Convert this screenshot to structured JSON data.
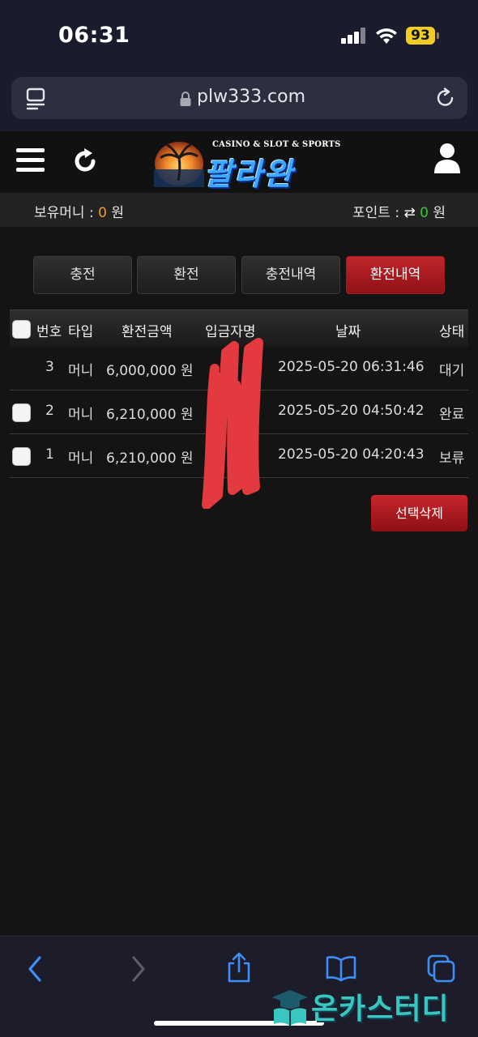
{
  "status_bar": {
    "time": "06:31",
    "battery": "93"
  },
  "browser": {
    "url": "plw333.com"
  },
  "header": {
    "logo_tagline": "CASINO & SLOT & SPORTS",
    "logo_name": "팔라완"
  },
  "balance": {
    "money_label": "보유머니 : ",
    "money_value": "0",
    "money_unit": " 원",
    "point_label": "포인트 : ",
    "point_swap_glyph": "⇄",
    "point_value": "0",
    "point_unit": " 원"
  },
  "tabs": [
    {
      "label": "충전",
      "active": false
    },
    {
      "label": "환전",
      "active": false
    },
    {
      "label": "충전내역",
      "active": false
    },
    {
      "label": "환전내역",
      "active": true
    }
  ],
  "table": {
    "columns": [
      "번호",
      "타입",
      "환전금액",
      "입금자명",
      "날짜",
      "상태"
    ],
    "rows": [
      {
        "no": "3",
        "type": "머니",
        "amount": "6,000,000 원",
        "depositor": "",
        "date": "2025-05-20 06:31:46",
        "status": "대기",
        "has_checkbox": false
      },
      {
        "no": "2",
        "type": "머니",
        "amount": "6,210,000 원",
        "depositor": "",
        "date": "2025-05-20 04:50:42",
        "status": "완료",
        "has_checkbox": true
      },
      {
        "no": "1",
        "type": "머니",
        "amount": "6,210,000 원",
        "depositor": "",
        "date": "2025-05-20 04:20:43",
        "status": "보류",
        "has_checkbox": true
      }
    ]
  },
  "actions": {
    "delete_selected": "선택삭제"
  },
  "watermark": {
    "text": "온카스터디"
  },
  "colors": {
    "accent_red": "#b51c22",
    "money_orange": "#f59a23",
    "point_green": "#35c735",
    "background": "#141414"
  },
  "icons": [
    "reader-icon",
    "lock-icon",
    "reload-icon",
    "menu-icon",
    "refresh-icon",
    "user-icon",
    "back-icon",
    "forward-icon",
    "share-icon",
    "bookmarks-icon",
    "tabs-icon"
  ]
}
